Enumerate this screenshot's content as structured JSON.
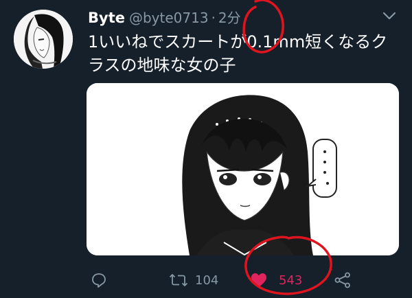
{
  "tweet": {
    "name": "Byte",
    "handle": "@byte0713",
    "separator": "·",
    "time": "2分",
    "text_line1": "1いいねでスカートが0.1mm短くなるク",
    "text_line2": "ラスの地味な女の子"
  },
  "actions": {
    "reply": {
      "icon": "reply-icon"
    },
    "retweet": {
      "icon": "retweet-icon",
      "count": "104"
    },
    "like": {
      "icon": "heart-icon",
      "count": "543",
      "liked": true
    },
    "share": {
      "icon": "share-icon"
    }
  },
  "colors": {
    "background": "#15202b",
    "text": "#ffffff",
    "secondary": "#8899a6",
    "like": "#e0245e",
    "annotation": "#e0141e"
  }
}
